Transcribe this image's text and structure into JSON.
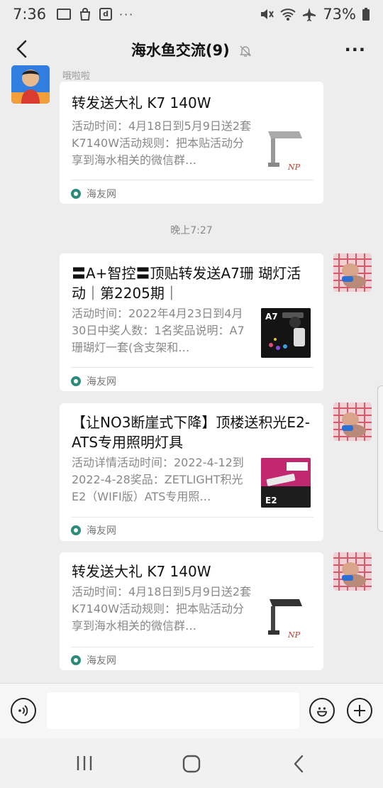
{
  "status_bar": {
    "time": "7:36",
    "battery": "73%",
    "icons": [
      "image-icon",
      "bag-icon",
      "d-app-icon",
      "more-dots-icon",
      "mute-icon",
      "wifi-icon",
      "airplane-icon",
      "battery-icon"
    ],
    "dots": "···"
  },
  "nav": {
    "title": "海水鱼交流(9)",
    "more": "···"
  },
  "sender_name": "哦啦啦",
  "timestamp": "晚上7:27",
  "messages": [
    {
      "side": "left",
      "title": "转发送大礼 K7 140W",
      "desc": "活动时间：4月18日到5月9日送2套K7140W活动规则：把本贴活动分享到海水相关的微信群…",
      "source": "海友网",
      "thumb": "lamp-image"
    },
    {
      "side": "right",
      "title": "〓A+智控〓顶贴转发送A7珊 瑚灯活动｜第2205期｜",
      "desc": "活动时间：2022年4月23日到4月30日中奖人数：1名奖品说明：A7珊瑚灯一套(含支架和…",
      "source": "海友网",
      "thumb": "a7-light-image",
      "thumb_label": "A7"
    },
    {
      "side": "right",
      "title": "【让NO3断崖式下降】顶楼送积光E2-ATS专用照明灯具",
      "desc": "活动详情活动时间：2022-4-12到2022-4-28奖品：ZETLIGHT积光E2（WIFI版）ATS专用照…",
      "source": "海友网",
      "thumb": "e2-light-image",
      "thumb_label": "E2"
    },
    {
      "side": "right",
      "title": "转发送大礼 K7 140W",
      "desc": "活动时间：4月18日到5月9日送2套K7140W活动规则：把本贴活动分享到海水相关的微信群…",
      "source": "海友网",
      "thumb": "lamp-image"
    }
  ],
  "colors": {
    "background": "#ededed",
    "card": "#ffffff",
    "desc_text": "#888888",
    "source_logo": "#2b8a7a"
  }
}
